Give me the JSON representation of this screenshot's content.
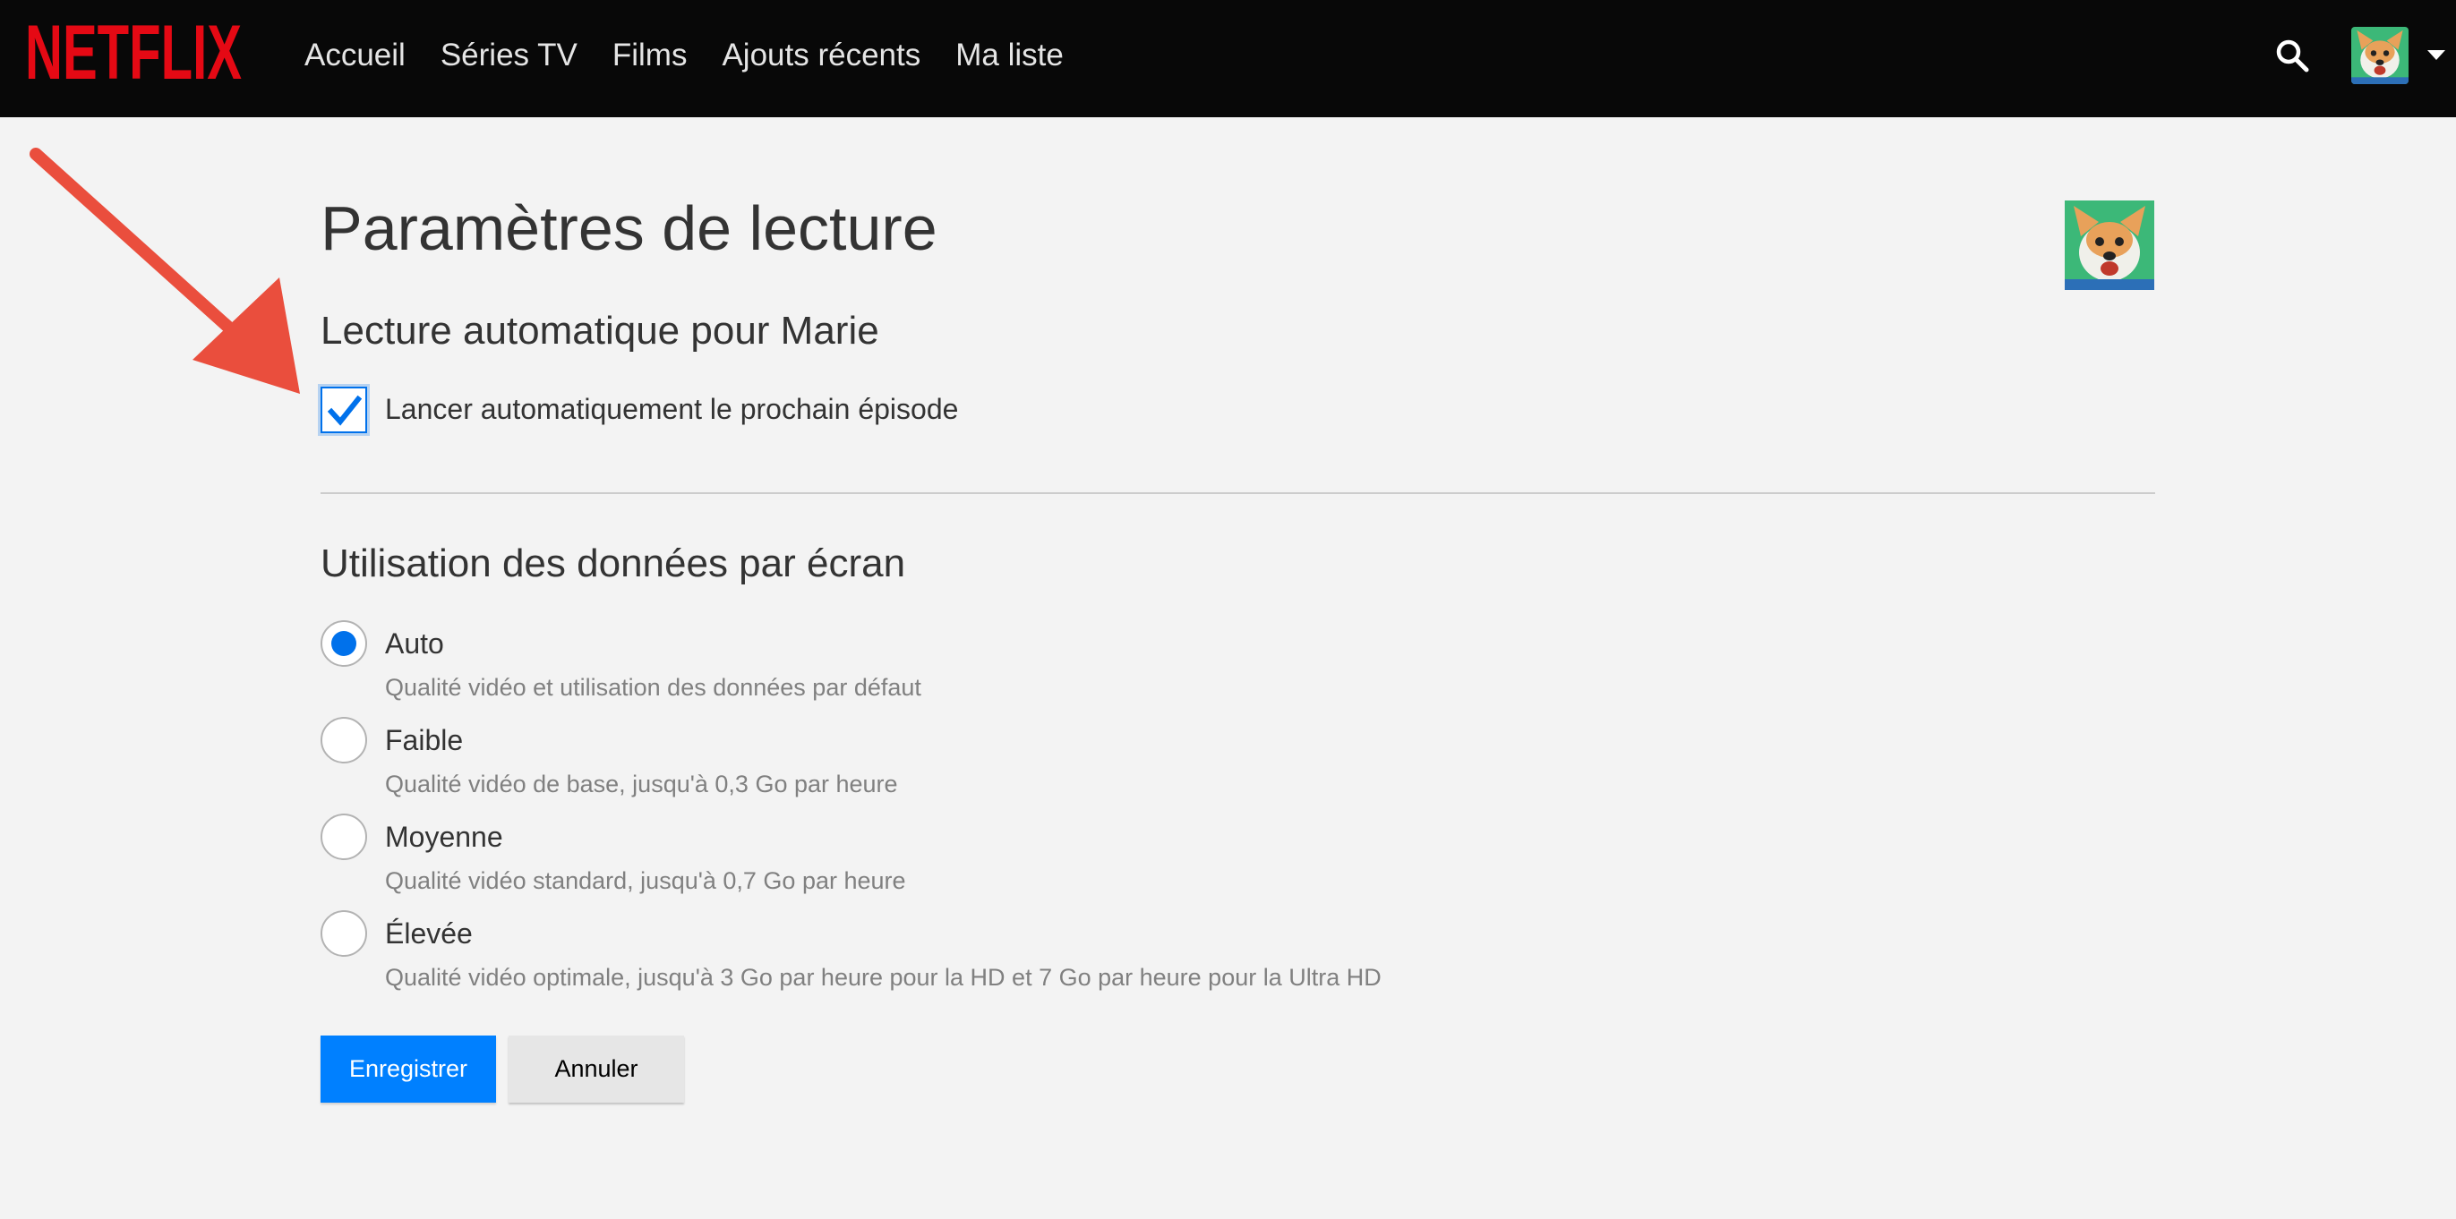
{
  "header": {
    "logo_text": "NETFLIX",
    "nav": [
      "Accueil",
      "Séries TV",
      "Films",
      "Ajouts récents",
      "Ma liste"
    ],
    "icons": [
      "search-icon",
      "avatar",
      "caret-down-icon"
    ]
  },
  "page": {
    "title": "Paramètres de lecture"
  },
  "autoplay": {
    "title": "Lecture automatique pour Marie",
    "checkbox_label": "Lancer automatiquement le prochain épisode",
    "checked": true
  },
  "data_usage": {
    "title": "Utilisation des données par écran",
    "options": [
      {
        "label": "Auto",
        "description": "Qualité vidéo et utilisation des données par défaut",
        "selected": true
      },
      {
        "label": "Faible",
        "description": "Qualité vidéo de base, jusqu'à 0,3 Go par heure",
        "selected": false
      },
      {
        "label": "Moyenne",
        "description": "Qualité vidéo standard, jusqu'à 0,7 Go par heure",
        "selected": false
      },
      {
        "label": "Élevée",
        "description": "Qualité vidéo optimale, jusqu'à 3 Go par heure pour la HD et 7 Go par heure pour la Ultra HD",
        "selected": false
      }
    ]
  },
  "buttons": {
    "save": "Enregistrer",
    "cancel": "Annuler"
  },
  "colors": {
    "brand_red": "#e50914",
    "accent_blue": "#0071eb",
    "save_blue": "#0080ff",
    "annotation_arrow": "#ea4e3d"
  }
}
